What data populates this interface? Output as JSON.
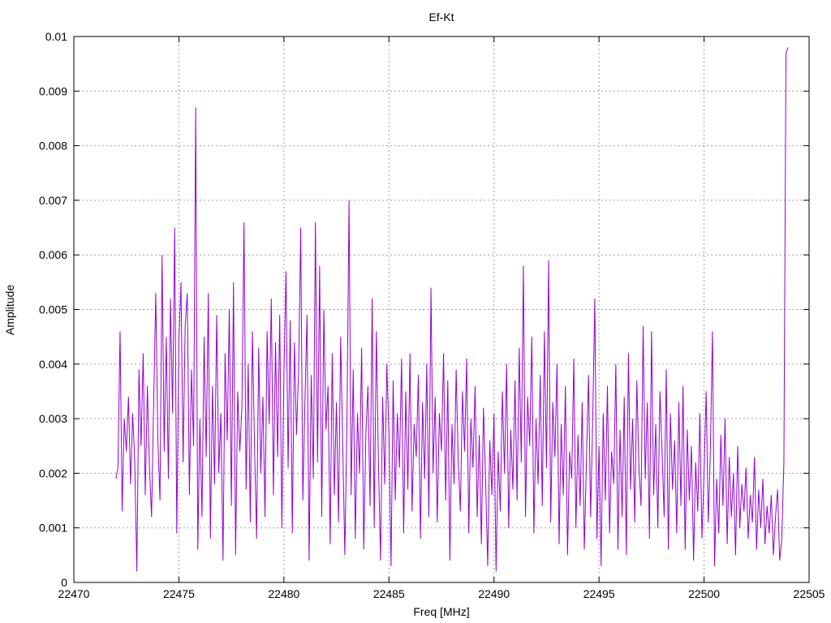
{
  "chart_data": {
    "type": "line",
    "title": "Ef-Kt",
    "xlabel": "Freq [MHz]",
    "ylabel": "Amplitude",
    "xlim": [
      22470,
      22505
    ],
    "ylim": [
      0,
      0.01
    ],
    "grid": true,
    "legend": "none",
    "x_ticks": [
      "22470",
      "22475",
      "22480",
      "22485",
      "22490",
      "22495",
      "22500",
      "22505"
    ],
    "y_ticks": [
      "0",
      "0.001",
      "0.002",
      "0.003",
      "0.004",
      "0.005",
      "0.006",
      "0.007",
      "0.008",
      "0.009",
      "0.01"
    ],
    "series": [
      {
        "name": "Ef-Kt",
        "color": "#9400d3",
        "x_start": 22472,
        "x_step": 0.1,
        "values": [
          0.0019,
          0.0021,
          0.0046,
          0.0013,
          0.003,
          0.0024,
          0.0034,
          0.0018,
          0.0031,
          0.0022,
          0.0002,
          0.0039,
          0.0025,
          0.0042,
          0.0016,
          0.0036,
          0.0021,
          0.0012,
          0.0033,
          0.0053,
          0.0026,
          0.0015,
          0.006,
          0.0024,
          0.0045,
          0.0019,
          0.0052,
          0.0031,
          0.0065,
          0.0009,
          0.0044,
          0.0055,
          0.0022,
          0.0047,
          0.0053,
          0.0016,
          0.0039,
          0.0025,
          0.0087,
          0.0006,
          0.003,
          0.0012,
          0.0045,
          0.0023,
          0.0053,
          0.0008,
          0.0036,
          0.0018,
          0.0049,
          0.002,
          0.0031,
          0.0004,
          0.0042,
          0.0026,
          0.005,
          0.0014,
          0.0055,
          0.0005,
          0.0035,
          0.0024,
          0.0032,
          0.0066,
          0.0017,
          0.004,
          0.0011,
          0.0046,
          0.0025,
          0.0008,
          0.0043,
          0.002,
          0.0034,
          0.0012,
          0.0046,
          0.0029,
          0.0052,
          0.0016,
          0.0044,
          0.0023,
          0.0049,
          0.001,
          0.0038,
          0.0057,
          0.0021,
          0.0048,
          0.0009,
          0.0044,
          0.0027,
          0.0039,
          0.0065,
          0.0015,
          0.0033,
          0.0049,
          0.0004,
          0.0038,
          0.0019,
          0.0066,
          0.0022,
          0.0058,
          0.0012,
          0.005,
          0.0028,
          0.0036,
          0.0007,
          0.0042,
          0.0016,
          0.0033,
          0.0011,
          0.0045,
          0.0025,
          0.0005,
          0.0029,
          0.007,
          0.0016,
          0.0039,
          0.0008,
          0.0031,
          0.002,
          0.0043,
          0.0006,
          0.0027,
          0.0036,
          0.0014,
          0.0052,
          0.001,
          0.0046,
          0.0022,
          0.0004,
          0.0034,
          0.0018,
          0.004,
          0.0027,
          0.0003,
          0.0037,
          0.0015,
          0.0031,
          0.0021,
          0.0041,
          0.0009,
          0.0035,
          0.0017,
          0.0042,
          0.0013,
          0.0029,
          0.0023,
          0.0038,
          0.0008,
          0.0033,
          0.0019,
          0.004,
          0.0012,
          0.0054,
          0.002,
          0.0034,
          0.0011,
          0.0031,
          0.0024,
          0.0042,
          0.0015,
          0.0037,
          0.0004,
          0.0029,
          0.0018,
          0.0039,
          0.0022,
          0.0013,
          0.0035,
          0.0024,
          0.0041,
          0.0009,
          0.003,
          0.0021,
          0.0036,
          0.0012,
          0.0027,
          0.0007,
          0.0032,
          0.0019,
          0.0003,
          0.0026,
          0.0016,
          0.0031,
          0.0002,
          0.0024,
          0.0013,
          0.0035,
          0.002,
          0.004,
          0.001,
          0.0028,
          0.0017,
          0.0037,
          0.0015,
          0.0043,
          0.0022,
          0.0058,
          0.0012,
          0.0034,
          0.0025,
          0.0045,
          0.0009,
          0.003,
          0.0018,
          0.0038,
          0.0014,
          0.0046,
          0.0021,
          0.0059,
          0.0011,
          0.0033,
          0.0023,
          0.004,
          0.0007,
          0.0029,
          0.0016,
          0.0036,
          0.0005,
          0.0024,
          0.0019,
          0.0041,
          0.001,
          0.0027,
          0.0014,
          0.0033,
          0.0006,
          0.0022,
          0.0038,
          0.0012,
          0.003,
          0.0052,
          0.0008,
          0.0025,
          0.0003,
          0.0031,
          0.0015,
          0.0036,
          0.0009,
          0.0024,
          0.0018,
          0.004,
          0.0006,
          0.0028,
          0.0012,
          0.0034,
          0.0005,
          0.0042,
          0.0017,
          0.003,
          0.0011,
          0.0037,
          0.0021,
          0.0014,
          0.0047,
          0.0019,
          0.0033,
          0.0008,
          0.0046,
          0.0016,
          0.0029,
          0.001,
          0.0035,
          0.0024,
          0.0012,
          0.0039,
          0.0006,
          0.0031,
          0.0017,
          0.0026,
          0.0009,
          0.0033,
          0.0014,
          0.0036,
          0.0006,
          0.0028,
          0.0015,
          0.0025,
          0.0004,
          0.0022,
          0.0013,
          0.0031,
          0.0008,
          0.002,
          0.0035,
          0.0011,
          0.0024,
          0.0046,
          0.0003,
          0.0019,
          0.0009,
          0.0027,
          0.0014,
          0.003,
          0.0007,
          0.0023,
          0.0012,
          0.002,
          0.0005,
          0.0025,
          0.001,
          0.0018,
          0.0013,
          0.0021,
          0.0008,
          0.0016,
          0.0011,
          0.0023,
          0.0006,
          0.0017,
          0.001,
          0.0019,
          0.0007,
          0.0014,
          0.0009,
          0.0016,
          0.0005,
          0.0012,
          0.0017,
          0.0004,
          0.0008,
          0.0022,
          0.0097,
          0.0098
        ]
      }
    ]
  }
}
